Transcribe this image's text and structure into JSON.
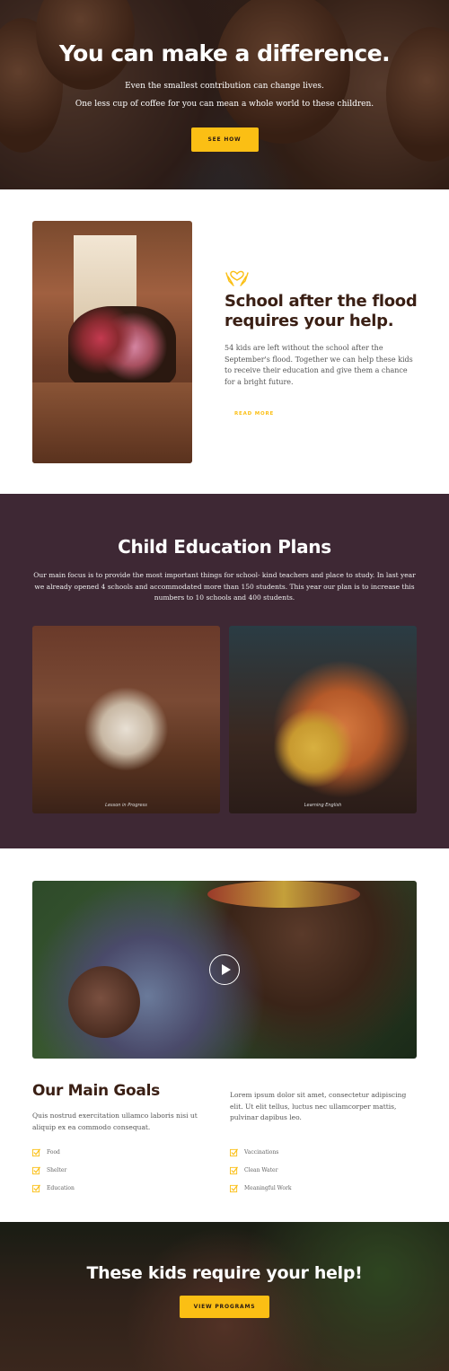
{
  "hero": {
    "title": "You can make a difference.",
    "subtitle_line1": "Even the smallest contribution can change lives.",
    "subtitle_line2": "One less cup of coffee for you can mean a whole world to these children.",
    "button": "SEE HOW"
  },
  "flood": {
    "icon": "hands-heart-icon",
    "title": "School after the flood requires your help.",
    "body": "54 kids are left without the school after the September's flood. Together we can help these kids to receive their education and give them a chance for a bright future.",
    "link": "READ MORE"
  },
  "plans": {
    "title": "Child Education Plans",
    "body": "Our main focus is to provide the most important things for school- kind teachers and place to study. In last year we already opened 4 schools and accommodated more than 150 students. This year our plan is to increase this numbers to 10 schools and 400 students.",
    "images": [
      {
        "caption": "Lesson in Progress"
      },
      {
        "caption": "Learning English"
      }
    ]
  },
  "goals": {
    "title": "Our Main Goals",
    "left_text": "Quis nostrud exercitation ullamco laboris nisi ut aliquip ex ea commodo consequat.",
    "right_text": "Lorem ipsum dolor sit amet, consectetur adipiscing elit. Ut elit tellus, luctus nec ullamcorper mattis, pulvinar dapibus leo.",
    "list_left": [
      "Food",
      "Shelter",
      "Education"
    ],
    "list_right": [
      "Vaccinations",
      "Clean Water",
      "Meaningful Work"
    ]
  },
  "cta": {
    "title": "These kids require your help!",
    "button": "VIEW PROGRAMS"
  },
  "colors": {
    "accent": "#fbbf14",
    "heading": "#3a1f14",
    "plans_bg": "#3e2834"
  }
}
